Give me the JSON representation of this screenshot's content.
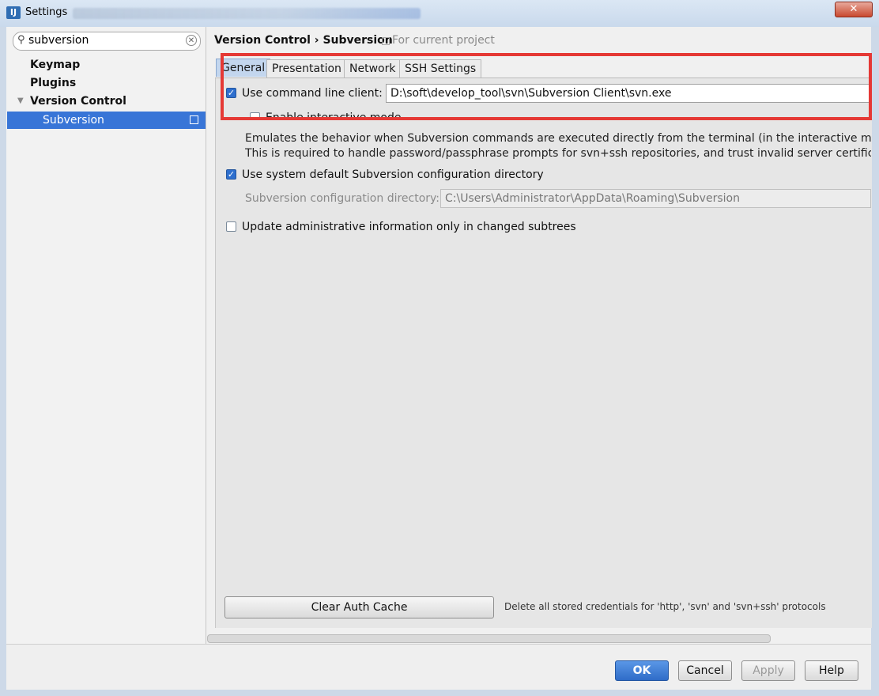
{
  "window": {
    "title": "Settings",
    "close_glyph": "✕",
    "app_icon": "IJ"
  },
  "sidebar": {
    "search_value": "subversion",
    "items": [
      {
        "label": "Keymap"
      },
      {
        "label": "Plugins"
      },
      {
        "label": "Version Control"
      }
    ],
    "selected": {
      "label": "Subversion"
    }
  },
  "header": {
    "breadcrumb": "Version Control › Subversion",
    "project_note": "For current project"
  },
  "tabs": [
    {
      "label": "General"
    },
    {
      "label": "Presentation"
    },
    {
      "label": "Network"
    },
    {
      "label": "SSH Settings"
    }
  ],
  "general": {
    "use_cmd_label": "Use command line client:",
    "use_cmd_checked": true,
    "cmd_path": "D:\\soft\\develop_tool\\svn\\Subversion Client\\svn.exe",
    "interactive_label": "Enable interactive mode",
    "interactive_checked": false,
    "desc_line1": "Emulates the behavior when Subversion commands are executed directly from the terminal (in the interactive mode).",
    "desc_line2": "This is required to handle password/passphrase prompts for svn+ssh repositories, and trust invalid server certificates fo",
    "use_default_dir_label": "Use system default Subversion configuration directory",
    "use_default_dir_checked": true,
    "config_dir_label": "Subversion configuration directory:",
    "config_dir_value": "C:\\Users\\Administrator\\AppData\\Roaming\\Subversion",
    "update_admin_label": "Update administrative information only in changed subtrees",
    "update_admin_checked": false,
    "clear_cache_label": "Clear Auth Cache",
    "clear_cache_hint": "Delete all stored credentials for 'http', 'svn' and 'svn+ssh' protocols"
  },
  "footer": {
    "ok": "OK",
    "cancel": "Cancel",
    "apply": "Apply",
    "help": "Help"
  },
  "colors": {
    "accent": "#3875d7",
    "highlight": "#e53935"
  }
}
